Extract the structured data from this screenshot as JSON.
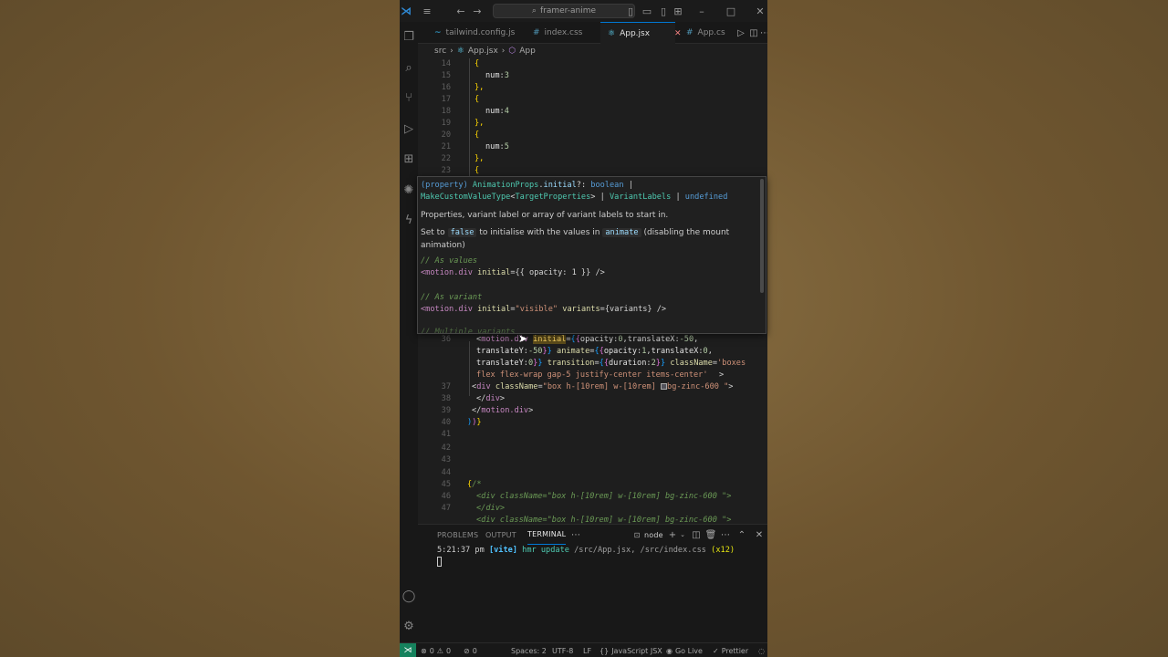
{
  "titlebar": {
    "search": "framer-anime",
    "icons": [
      "vscode-logo",
      "menu",
      "back",
      "forward",
      "search",
      "toggle-sidebar",
      "toggle-panel",
      "toggle-secondary",
      "layout",
      "minimize",
      "maximize",
      "close"
    ]
  },
  "activitybar": [
    "explorer",
    "search",
    "source-control",
    "run-debug",
    "extensions",
    "chatgpt",
    "remote",
    "account",
    "settings"
  ],
  "tabs": [
    {
      "label": "tailwind.config.js",
      "icon": "~",
      "color": "#38bdf8"
    },
    {
      "label": "index.css",
      "icon": "#",
      "color": "#519aba"
    },
    {
      "label": "App.jsx",
      "icon": "⚛",
      "color": "#61dafb",
      "active": true
    },
    {
      "label": "App.cs",
      "icon": "#",
      "color": "#519aba"
    }
  ],
  "breadcrumb": {
    "folder": "src",
    "file": "App.jsx",
    "symbol": "App"
  },
  "hover": {
    "signature_parts": [
      {
        "t": "(property) ",
        "c": "#569cd6"
      },
      {
        "t": "AnimationProps",
        "c": "#4ec9b0"
      },
      {
        "t": ".",
        "c": "#d4d4d4"
      },
      {
        "t": "initial",
        "c": "#9cdcfe"
      },
      {
        "t": "?: ",
        "c": "#d4d4d4"
      },
      {
        "t": "boolean",
        "c": "#569cd6"
      },
      {
        "t": " |",
        "c": "#d4d4d4"
      },
      {
        "t": "MakeCustomValueType",
        "c": "#4ec9b0"
      },
      {
        "t": "<",
        "c": "#d4d4d4"
      },
      {
        "t": "TargetProperties",
        "c": "#4ec9b0"
      },
      {
        "t": "> | ",
        "c": "#d4d4d4"
      },
      {
        "t": "VariantLabels",
        "c": "#4ec9b0"
      },
      {
        "t": " | ",
        "c": "#d4d4d4"
      },
      {
        "t": "undefined",
        "c": "#569cd6"
      }
    ],
    "description": "Properties, variant label or array of variant labels to start in.",
    "set_to": "Set to",
    "false_code": "false",
    "mid_text": "to initialise with the values in",
    "animate_code": "animate",
    "end_text": "(disabling the mount animation)",
    "comment1": "// As values",
    "example1_open": "<motion.div",
    "example1_attr": " initial",
    "example1_rest": "={{ opacity: 1 }} />",
    "comment2": "// As variant",
    "example2_open": "<motion.div",
    "example2_attr": " initial",
    "example2_eq": "=",
    "example2_val": "\"visible\"",
    "example2_attr2": " variants",
    "example2_rest": "={variants} />",
    "comment3": "// Multiple variants"
  },
  "code_lines": {
    "n14": "14",
    "n15": "15",
    "n16": "16",
    "n17": "17",
    "n18": "18",
    "n19": "19",
    "n20": "20",
    "n21": "21",
    "n22": "22",
    "n23": "23",
    "n36": "36",
    "n37": "37",
    "n38": "38",
    "n39": "39",
    "n40": "40",
    "n41": "41",
    "n42": "42",
    "n43": "43",
    "n44": "44",
    "n45": "45",
    "n46": "46",
    "n47": "47",
    "num_key": "num",
    "v3": "3",
    "v4": "4",
    "v5": "5"
  },
  "panel": {
    "tabs": [
      "PROBLEMS",
      "OUTPUT",
      "TERMINAL"
    ],
    "shell": "node",
    "time": "5:21:37 pm",
    "vite": "[vite]",
    "message": "hmr update",
    "files": "/src/App.jsx, /src/index.css",
    "count": "(x12)"
  },
  "statusbar": {
    "errors": "0",
    "warnings": "0",
    "ports": "0",
    "spaces": "Spaces: 2",
    "encoding": "UTF-8",
    "eol": "LF",
    "language": "JavaScript JSX",
    "golive": "Go Live",
    "prettier": "Prettier"
  }
}
